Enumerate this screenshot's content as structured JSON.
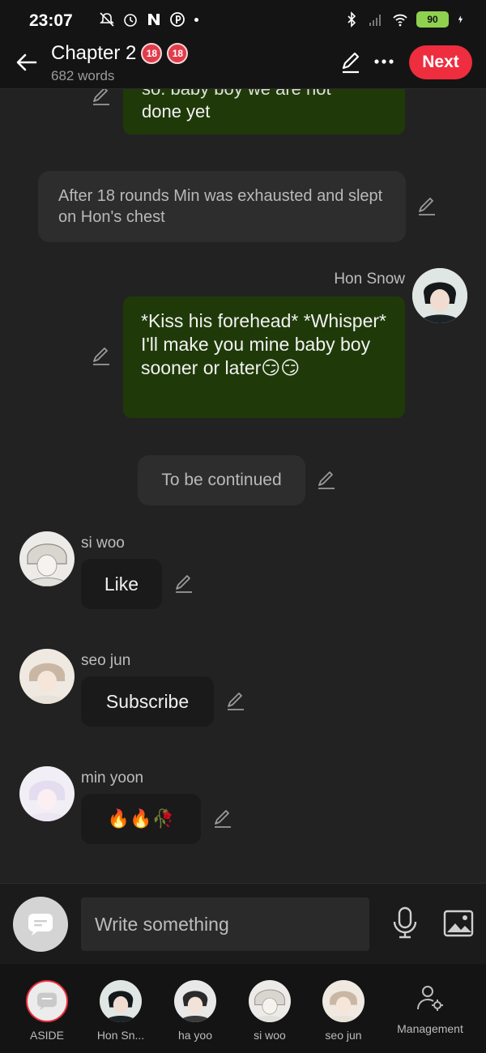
{
  "status_bar": {
    "time": "23:07",
    "battery": "90",
    "icons": [
      "bell-off-icon",
      "alarm-icon",
      "n-app-icon",
      "pinterest-icon",
      "bluetooth-icon",
      "signal-icon",
      "wifi-icon",
      "charging-icon"
    ]
  },
  "header": {
    "title": "Chapter 2",
    "badges": [
      "18",
      "18"
    ],
    "word_count": "682 words",
    "next_label": "Next"
  },
  "messages": [
    {
      "type": "green",
      "text_top": "so. baby boy we are not",
      "text": "done yet"
    },
    {
      "type": "narration",
      "text": "After 18 rounds Min was exhausted and slept on Hon's chest"
    },
    {
      "type": "green",
      "sender": "Hon Snow",
      "text": "*Kiss his forehead* *Whisper* I'll make you mine baby boy sooner or later😏😏"
    },
    {
      "type": "narration",
      "text": "To be continued"
    },
    {
      "type": "character",
      "sender": "si woo",
      "text": "Like"
    },
    {
      "type": "character",
      "sender": "seo jun",
      "text": "Subscribe"
    },
    {
      "type": "character",
      "sender": "min yoon",
      "text": "🔥🔥🥀"
    }
  ],
  "composer": {
    "placeholder": "Write something"
  },
  "characters": [
    {
      "label": "ASIDE"
    },
    {
      "label": "Hon Sn..."
    },
    {
      "label": "ha yoo"
    },
    {
      "label": "si woo"
    },
    {
      "label": "seo jun"
    },
    {
      "label": "Management"
    }
  ],
  "colors": {
    "accent": "#ee2d3e",
    "green_bubble": "#1f3a08",
    "background": "#222222"
  }
}
